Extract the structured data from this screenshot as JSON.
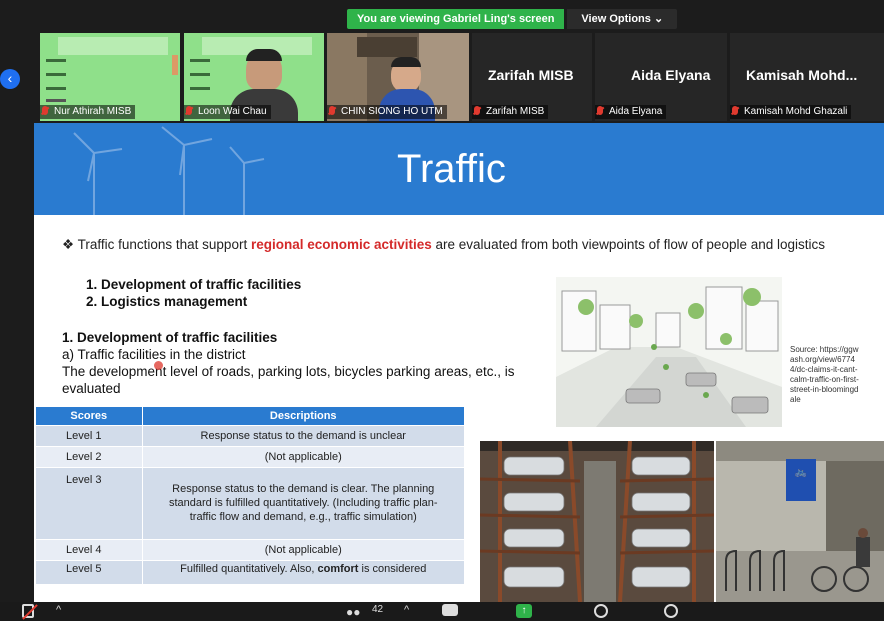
{
  "banner": {
    "viewing_text": "You are viewing Gabriel Ling's screen",
    "options_label": "View Options ⌄"
  },
  "participants": [
    {
      "name": "Nur Athirah MISB"
    },
    {
      "name": "Loon Wai Chau"
    },
    {
      "name": "CHIN SIONG HO UTM"
    },
    {
      "name": "Zarifah MISB",
      "display": "Zarifah MISB"
    },
    {
      "name": "Aida Elyana",
      "display": "Aida Elyana"
    },
    {
      "name": "Kamisah Mohd Ghazali",
      "display": "Kamisah Mohd..."
    }
  ],
  "slide": {
    "title": "Traffic",
    "bullet_before": "Traffic functions that support ",
    "bullet_highlight": "regional economic activities",
    "bullet_after": " are evaluated from both viewpoints of flow of people and logistics",
    "list": [
      "1.  Development of traffic facilities",
      "2.  Logistics management"
    ],
    "section_heading": "1.  Development of traffic facilities",
    "section_sub": "a)  Traffic facilities in the district",
    "section_text": "The development level of roads, parking lots, bicycles parking areas, etc., is evaluated",
    "source": "Source: https://ggwash.org/view/67744/dc-claims-it-cant-calm-traffic-on-first-street-in-bloomingdale",
    "table": {
      "headers": [
        "Scores",
        "Descriptions"
      ],
      "rows": [
        {
          "score": "Level 1",
          "desc": "Response status to the demand is unclear"
        },
        {
          "score": "Level 2",
          "desc": "(Not applicable)"
        },
        {
          "score": "Level 3",
          "desc": "Response status to the demand is clear. The planning standard is fulfilled quantitatively. (Including traffic plan- traffic flow and demand, e.g., traffic simulation)"
        },
        {
          "score": "Level 4",
          "desc": "(Not applicable)"
        },
        {
          "score": "Level 5",
          "desc_before": "Fulfilled quantitatively. Also, ",
          "desc_bold": "comfort",
          "desc_after": " is considered"
        }
      ]
    }
  },
  "toolbar": {
    "participants_count": "42"
  }
}
